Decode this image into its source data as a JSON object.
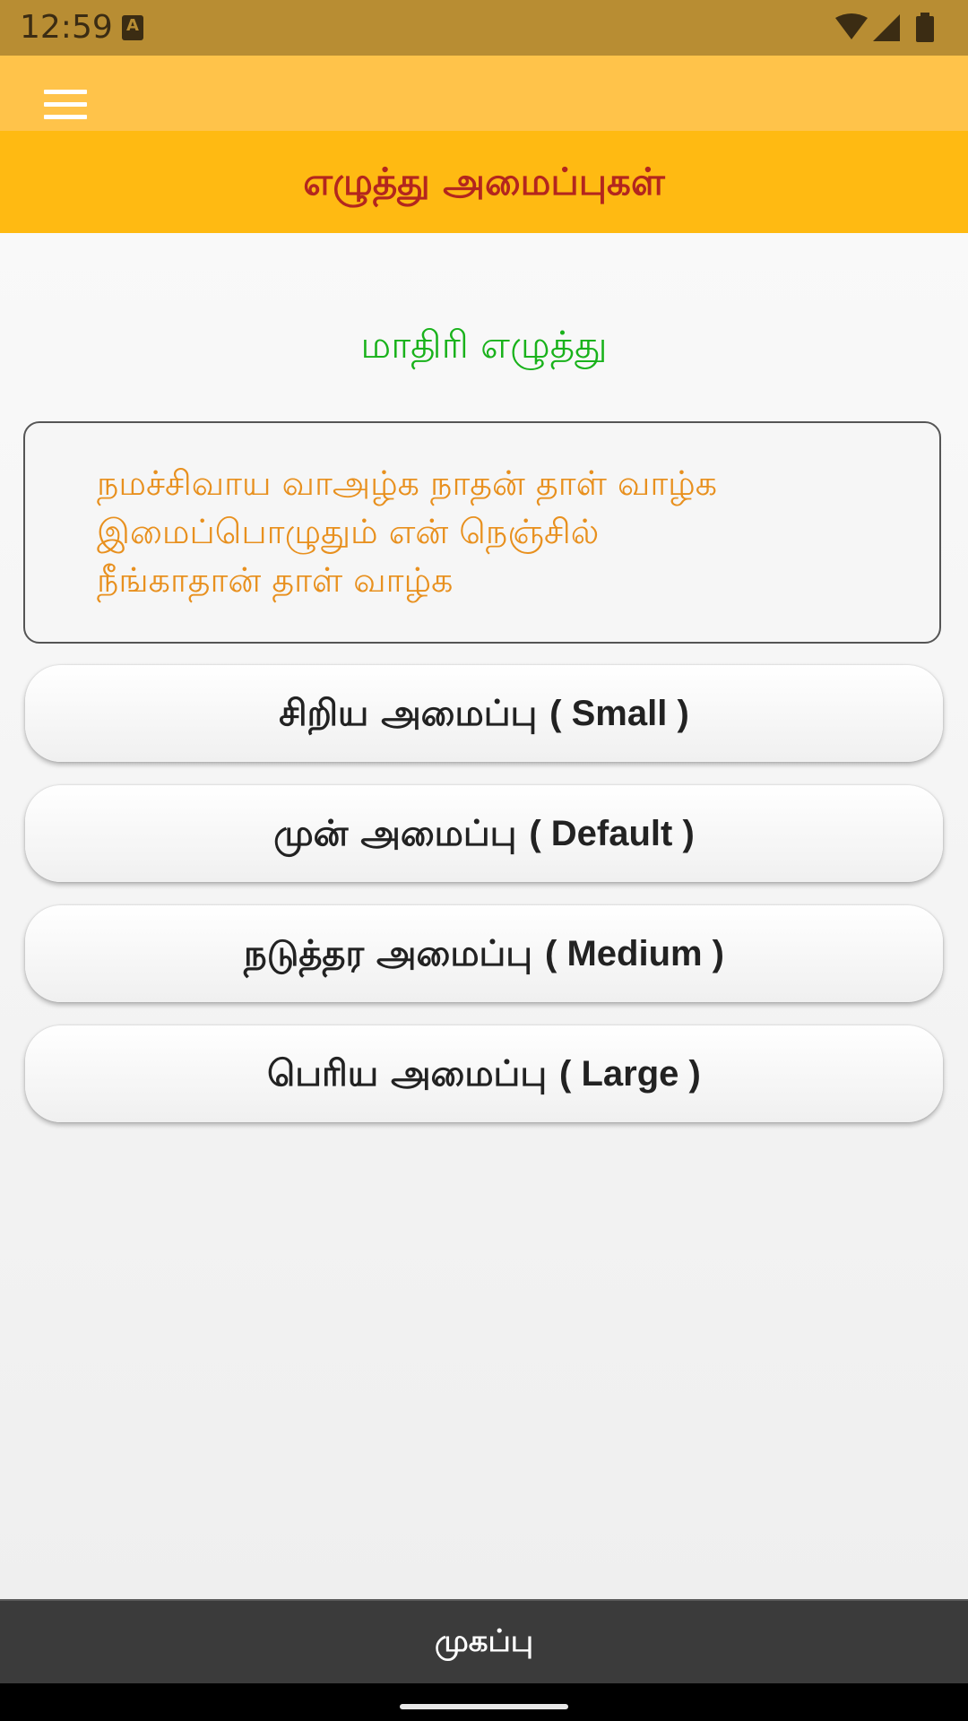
{
  "status_bar": {
    "time": "12:59",
    "notification_icon": "A",
    "icons": [
      "wifi-icon",
      "signal-icon",
      "battery-icon"
    ]
  },
  "app_bar": {
    "menu_icon": "hamburger-menu-icon"
  },
  "header": {
    "title": "எழுத்து அமைப்புகள்"
  },
  "sample": {
    "label": "மாதிரி எழுத்து",
    "lines": [
      "நமச்சிவாய வாஅழ்க நாதன் தாள் வாழ்க",
      "இமைப்பொழுதும் என் நெஞ்சில்",
      "நீங்காதான் தாள் வாழ்க"
    ]
  },
  "options": [
    {
      "tamil": "சிறிய அமைப்பு",
      "english": "( Small )"
    },
    {
      "tamil": "முன் அமைப்பு",
      "english": "( Default )"
    },
    {
      "tamil": "நடுத்தர அமைப்பு",
      "english": "( Medium )"
    },
    {
      "tamil": "பெரிய அமைப்பு",
      "english": "( Large )"
    }
  ],
  "bottom_bar": {
    "label": "முகப்பு"
  },
  "colors": {
    "status_bar": "#B88D33",
    "app_bar": "#FFC34A",
    "header_band": "#FFBA12",
    "header_text": "#B3261E",
    "sample_label": "#19B21B",
    "sample_text": "#E8901E",
    "bottom_bar": "#3b3b3b"
  }
}
